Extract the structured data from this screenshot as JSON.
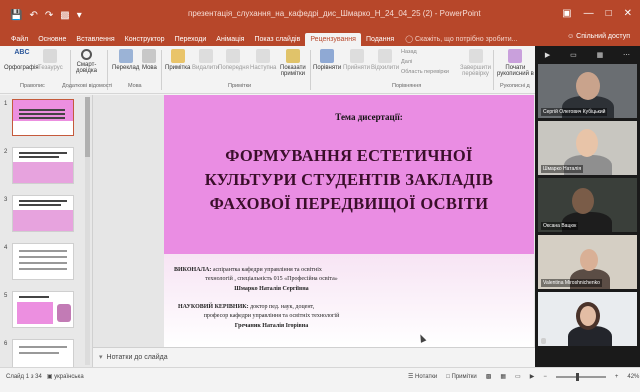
{
  "titlebar": {
    "document_title": "презентація_слухання_на_кафедрі_дис_Шмарко_Н_24_04_25 (2)  -  PowerPoint",
    "qat_icons": [
      "save-icon",
      "undo-icon",
      "redo-icon",
      "start-from-beginning-icon",
      "customize-qat-icon"
    ],
    "window_controls": [
      "ribbon-display-options-icon",
      "minimize-icon",
      "restore-icon",
      "close-icon"
    ]
  },
  "menu": {
    "tabs": [
      "Файл",
      "Основне",
      "Вставлення",
      "Конструктор",
      "Переходи",
      "Анімація",
      "Показ слайдів",
      "Рецензування",
      "Подання"
    ],
    "active_tab": "Рецензування",
    "tell_me": "Скажіть, що потрібно зробити...",
    "share": "Спільний доступ"
  },
  "ribbon": {
    "spelling": "Орфографія",
    "thesaurus": "Тезаурус",
    "smart_lookup_1": "Смарт-",
    "smart_lookup_2": "довідка",
    "translate": "Переклад",
    "language": "Мова",
    "new_comment": "Примітка",
    "delete_comment": "Видалити",
    "prev_comment": "Попередня",
    "next_comment": "Наступна",
    "show_comments_1": "Показати",
    "show_comments_2": "примітки",
    "compare": "Порівняти",
    "accept": "Прийняти",
    "reject": "Відхилити",
    "previous": "Назад",
    "next": "Далі",
    "reviewing_pane": "Область перевірки",
    "end_review_1": "Завершити",
    "end_review_2": "перевірку",
    "ink_1": "Почати",
    "ink_2": "рукописний в",
    "groups": {
      "proofing": "Правопис",
      "insights": "Додаткові відомості",
      "language": "Мова",
      "comments": "Примітки",
      "compare": "Порівняння",
      "ink": "Рукописні д"
    }
  },
  "thumbnails": {
    "numbers": [
      "1",
      "2",
      "3",
      "4",
      "5",
      "6"
    ]
  },
  "slide": {
    "theme_label": "Тема дисертації:",
    "title_line1": "ФОРМУВАННЯ ЕСТЕТИЧНОЇ",
    "title_line2": "КУЛЬТУРИ СТУДЕНТІВ ЗАКЛАДІВ",
    "title_line3": "ФАХОВОЇ ПЕРЕДВИЩОЇ ОСВІТИ",
    "performer_label": "ВИКОНАЛА:",
    "performer_text": " аспірантка кафедри управління та освітніх",
    "performer_line2": "технологій , спеціальність 015 «Професійна освіта»",
    "performer_name": "Шмарко Наталія Сергіївна",
    "supervisor_label": "НАУКОВИЙ КЕРІВНИК:",
    "supervisor_text": " доктор пед. наук, доцент,",
    "supervisor_line2": "професор кафедри управління та освітніх технологій",
    "supervisor_name": "Гречаник Наталія Ігорівна"
  },
  "notes": {
    "placeholder": "Нотатки до слайда"
  },
  "status": {
    "slide_count": "Слайд 1 з 34",
    "language": "українська",
    "notes_btn": "Нотатки",
    "comments_btn": "Примітки",
    "zoom": "42%"
  },
  "video": {
    "participants": [
      "Сергій Олегович Кубіцький",
      "Шмарко Наталія",
      "Оксана Вацюк",
      "Valentina Miroshnichenko",
      ""
    ]
  },
  "colors": {
    "accent": "#b7472a",
    "slide_pink": "#ea8de3",
    "title_text": "#3a0e2a"
  }
}
